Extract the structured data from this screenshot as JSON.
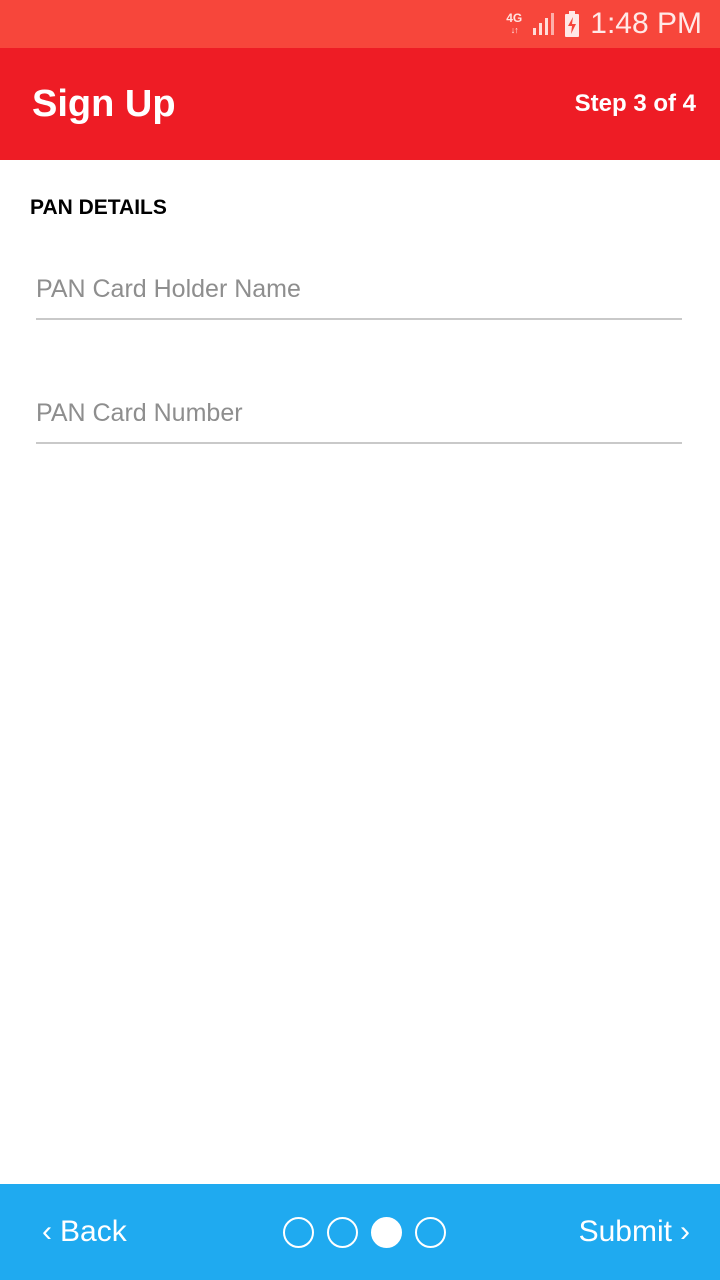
{
  "status_bar": {
    "network": "4G",
    "network_arrows": "↓↑",
    "time": "1:48 PM",
    "icons": [
      "network-4g-icon",
      "signal-icon",
      "battery-charging-icon"
    ]
  },
  "app_bar": {
    "title": "Sign Up",
    "step": "Step 3 of 4"
  },
  "form": {
    "section_title": "PAN DETAILS",
    "holder_name": {
      "placeholder": "PAN Card Holder Name",
      "value": ""
    },
    "card_number": {
      "placeholder": "PAN Card Number",
      "value": ""
    }
  },
  "bottom_bar": {
    "back_label": "Back",
    "submit_label": "Submit",
    "back_chevron": "‹",
    "submit_chevron": "›",
    "pager": {
      "total": 4,
      "current": 3
    }
  },
  "colors": {
    "status_bar": "#f7463b",
    "app_bar": "#ee1c25",
    "bottom_bar": "#1faaf0"
  }
}
